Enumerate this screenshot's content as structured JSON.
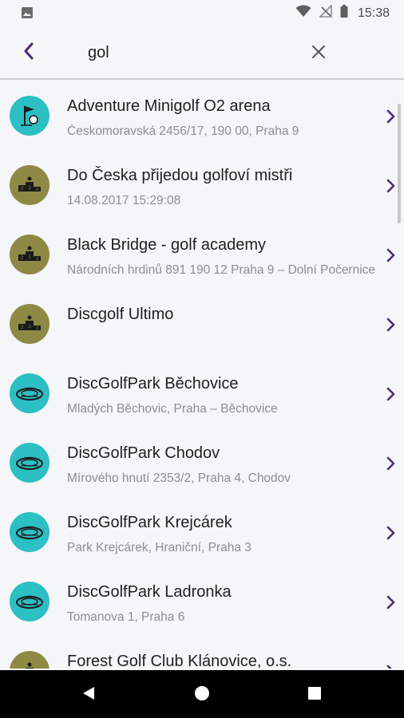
{
  "status_bar": {
    "time": "15:38"
  },
  "search": {
    "value": "gol"
  },
  "results": [
    {
      "title": "Adventure Minigolf O2 arena",
      "subtitle": "Českomoravská 2456/17, 190 00, Praha 9",
      "icon": "minigolf-flag-icon",
      "color": "#2cbfc3"
    },
    {
      "title": "Do Česka přijedou golfoví mistři",
      "subtitle": "14.08.2017 15:29:08",
      "icon": "podium-icon",
      "color": "#8e8a45"
    },
    {
      "title": "Black Bridge - golf academy",
      "subtitle": "Národních hrdinů 891 190 12 Praha 9 – Dolní Počernice",
      "icon": "podium-icon",
      "color": "#8e8a45"
    },
    {
      "title": "Discgolf Ultimo",
      "subtitle": "",
      "icon": "podium-icon",
      "color": "#8e8a45"
    },
    {
      "title": "DiscGolfPark Běchovice",
      "subtitle": "Mladých Běchovic, Praha – Běchovice",
      "icon": "disc-icon",
      "color": "#2cbfc3"
    },
    {
      "title": "DiscGolfPark Chodov",
      "subtitle": "Mírového hnutí 2353/2, Praha 4, Chodov",
      "icon": "disc-icon",
      "color": "#2cbfc3"
    },
    {
      "title": "DiscGolfPark Krejcárek",
      "subtitle": "Park Krejcárek, Hraniční, Praha 3",
      "icon": "disc-icon",
      "color": "#2cbfc3"
    },
    {
      "title": "DiscGolfPark Ladronka",
      "subtitle": "Tomanova 1, Praha 6",
      "icon": "disc-icon",
      "color": "#2cbfc3"
    },
    {
      "title": "Forest Golf Club Klánovice, o.s.",
      "subtitle": "",
      "icon": "podium-icon",
      "color": "#8e8a45"
    }
  ],
  "colors": {
    "accent": "#4a2a7a",
    "teal": "#2cbfc3",
    "olive": "#8e8a45"
  }
}
